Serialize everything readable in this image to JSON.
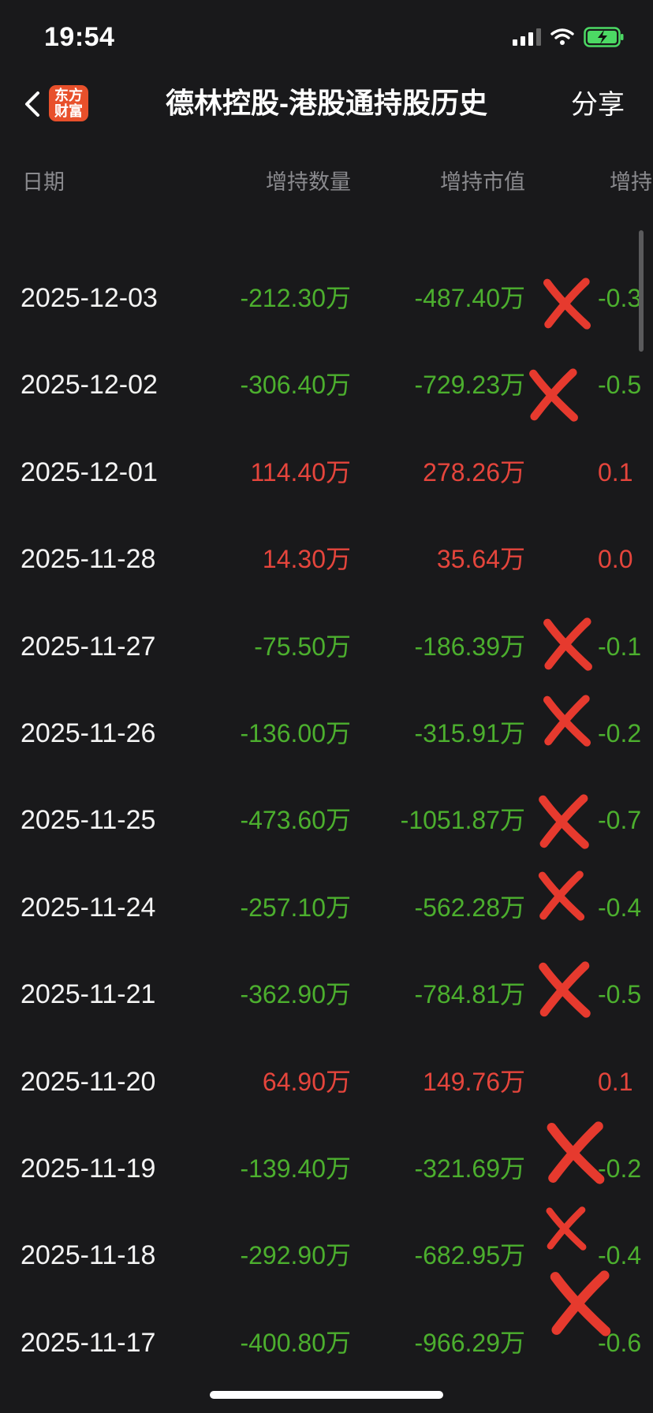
{
  "status_bar": {
    "time": "19:54"
  },
  "nav": {
    "logo_line1": "东方",
    "logo_line2": "财富",
    "title": "德林控股-港股通持股历史",
    "share_label": "分享"
  },
  "table": {
    "headers": {
      "date": "日期",
      "qty": "增持数量",
      "value": "增持市值",
      "pct": "增持"
    },
    "rows": [
      {
        "date": "2025-12-03",
        "qty": "-212.30万",
        "value": "-487.40万",
        "pct": "-0.3",
        "sign": "neg"
      },
      {
        "date": "2025-12-02",
        "qty": "-306.40万",
        "value": "-729.23万",
        "pct": "-0.5",
        "sign": "neg"
      },
      {
        "date": "2025-12-01",
        "qty": "114.40万",
        "value": "278.26万",
        "pct": "0.1",
        "sign": "pos"
      },
      {
        "date": "2025-11-28",
        "qty": "14.30万",
        "value": "35.64万",
        "pct": "0.0",
        "sign": "pos"
      },
      {
        "date": "2025-11-27",
        "qty": "-75.50万",
        "value": "-186.39万",
        "pct": "-0.1",
        "sign": "neg"
      },
      {
        "date": "2025-11-26",
        "qty": "-136.00万",
        "value": "-315.91万",
        "pct": "-0.2",
        "sign": "neg"
      },
      {
        "date": "2025-11-25",
        "qty": "-473.60万",
        "value": "-1051.87万",
        "pct": "-0.7",
        "sign": "neg"
      },
      {
        "date": "2025-11-24",
        "qty": "-257.10万",
        "value": "-562.28万",
        "pct": "-0.4",
        "sign": "neg"
      },
      {
        "date": "2025-11-21",
        "qty": "-362.90万",
        "value": "-784.81万",
        "pct": "-0.5",
        "sign": "neg"
      },
      {
        "date": "2025-11-20",
        "qty": "64.90万",
        "value": "149.76万",
        "pct": "0.1",
        "sign": "pos"
      },
      {
        "date": "2025-11-19",
        "qty": "-139.40万",
        "value": "-321.69万",
        "pct": "-0.2",
        "sign": "neg"
      },
      {
        "date": "2025-11-18",
        "qty": "-292.90万",
        "value": "-682.95万",
        "pct": "-0.4",
        "sign": "neg"
      },
      {
        "date": "2025-11-17",
        "qty": "-400.80万",
        "value": "-966.29万",
        "pct": "-0.6",
        "sign": "neg"
      }
    ]
  },
  "colors": {
    "negative": "#4caf2e",
    "positive": "#e5453c",
    "annotation": "#e63a2e",
    "background": "#19191b"
  }
}
